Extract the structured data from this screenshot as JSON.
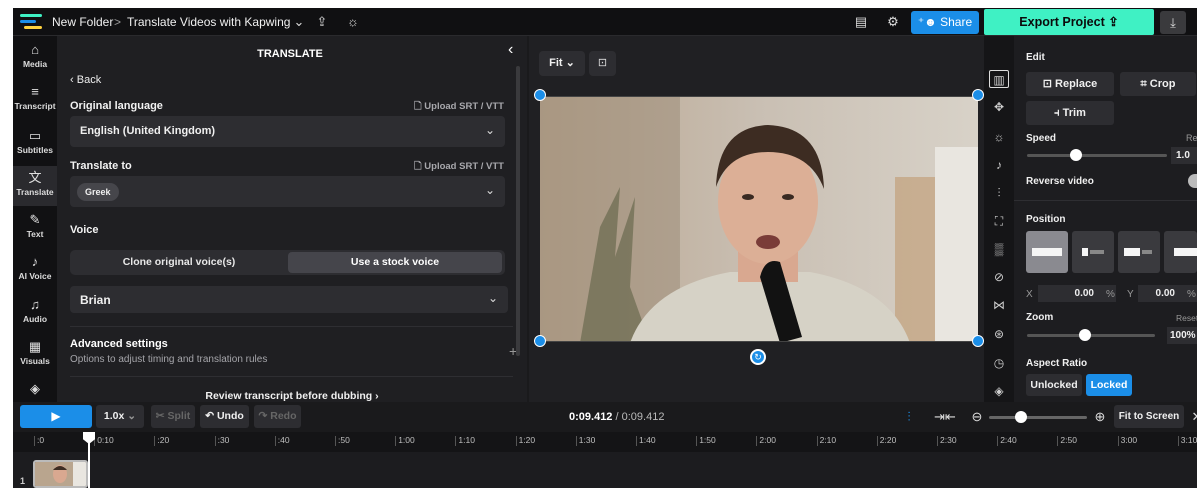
{
  "topbar": {
    "folder": "New Folder",
    "separator": ">",
    "project_title": "Translate Videos with Kapwing",
    "share_label": "Share",
    "export_label": "Export Project"
  },
  "nav": {
    "items": [
      {
        "label": "Media",
        "icon": "media-icon"
      },
      {
        "label": "Transcript",
        "icon": "transcript-icon"
      },
      {
        "label": "Subtitles",
        "icon": "subtitles-icon"
      },
      {
        "label": "Translate",
        "icon": "translate-icon"
      },
      {
        "label": "Text",
        "icon": "text-icon"
      },
      {
        "label": "AI Voice",
        "icon": "ai-voice-icon"
      },
      {
        "label": "Audio",
        "icon": "audio-icon"
      },
      {
        "label": "Visuals",
        "icon": "visuals-icon"
      }
    ]
  },
  "translate": {
    "title": "TRANSLATE",
    "back": "Back",
    "original_language_label": "Original language",
    "upload_label": "Upload SRT / VTT",
    "original_language_value": "English (United Kingdom)",
    "translate_to_label": "Translate to",
    "translate_to_value": "Greek",
    "voice_label": "Voice",
    "voice_options": [
      "Clone original voice(s)",
      "Use a stock voice"
    ],
    "voice_selected": "Use a stock voice",
    "stock_voice": "Brian",
    "advanced_title": "Advanced settings",
    "advanced_subtitle": "Options to adjust timing and translation rules",
    "review_label": "Review transcript before dubbing"
  },
  "stage": {
    "fit_label": "Fit"
  },
  "edit": {
    "title": "Edit",
    "replace": "Replace",
    "crop": "Crop",
    "trim": "Trim",
    "speed_label": "Speed",
    "speed_reset": "Re",
    "speed_value": "1.0",
    "speed_level": 0.35,
    "reverse_label": "Reverse video",
    "position_label": "Position",
    "x_label": "X",
    "x_value": "0.00",
    "y_label": "Y",
    "y_value": "0.00",
    "percent": "%",
    "zoom_label": "Zoom",
    "zoom_reset": "Reset",
    "zoom_value": "100%",
    "zoom_level": 0.45,
    "aspect_label": "Aspect Ratio",
    "unlocked": "Unlocked",
    "locked": "Locked"
  },
  "timeline": {
    "speed": "1.0x",
    "split": "Split",
    "undo": "Undo",
    "redo": "Redo",
    "current_time": "0:09.412",
    "total_time": "/ 0:09.412",
    "fit_to_screen": "Fit to Screen",
    "track_number": "1",
    "ticks": [
      ":0",
      "0:10",
      ":20",
      ":30",
      ":40",
      ":50",
      "1:00",
      "1:10",
      "1:20",
      "1:30",
      "1:40",
      "1:50",
      "2:00",
      "2:10",
      "2:20",
      "2:30",
      "2:40",
      "2:50",
      "3:00",
      "3:10"
    ]
  },
  "colors": {
    "accent_blue": "#1b8ee8",
    "export_green": "#3ff1c4",
    "panel_bg": "#1f1f22"
  }
}
